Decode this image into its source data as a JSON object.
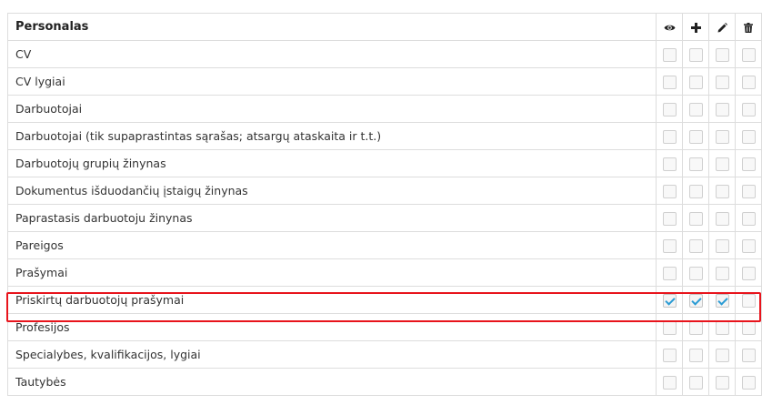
{
  "section_title": "Personalas",
  "permission_icons": [
    "eye-icon",
    "plus-icon",
    "pencil-icon",
    "trash-icon"
  ],
  "highlight_color": "#e8141c",
  "check_color": "#2a9bd4",
  "rows": [
    {
      "label": "CV",
      "checked": [
        false,
        false,
        false,
        false
      ]
    },
    {
      "label": "CV lygiai",
      "checked": [
        false,
        false,
        false,
        false
      ]
    },
    {
      "label": "Darbuotojai",
      "checked": [
        false,
        false,
        false,
        false
      ]
    },
    {
      "label": "Darbuotojai (tik supaprastintas sąrašas; atsargų ataskaita ir t.t.)",
      "checked": [
        false,
        false,
        false,
        false
      ]
    },
    {
      "label": "Darbuotojų grupių žinynas",
      "checked": [
        false,
        false,
        false,
        false
      ]
    },
    {
      "label": "Dokumentus išduodančių įstaigų žinynas",
      "checked": [
        false,
        false,
        false,
        false
      ]
    },
    {
      "label": "Paprastasis darbuotoju žinynas",
      "checked": [
        false,
        false,
        false,
        false
      ]
    },
    {
      "label": "Pareigos",
      "checked": [
        false,
        false,
        false,
        false
      ]
    },
    {
      "label": "Prašymai",
      "checked": [
        false,
        false,
        false,
        false
      ]
    },
    {
      "label": "Priskirtų darbuotojų prašymai",
      "checked": [
        true,
        true,
        true,
        false
      ]
    },
    {
      "label": "Profesijos",
      "checked": [
        false,
        false,
        false,
        false
      ]
    },
    {
      "label": "Specialybes, kvalifikacijos, lygiai",
      "checked": [
        false,
        false,
        false,
        false
      ]
    },
    {
      "label": "Tautybės",
      "checked": [
        false,
        false,
        false,
        false
      ]
    }
  ]
}
